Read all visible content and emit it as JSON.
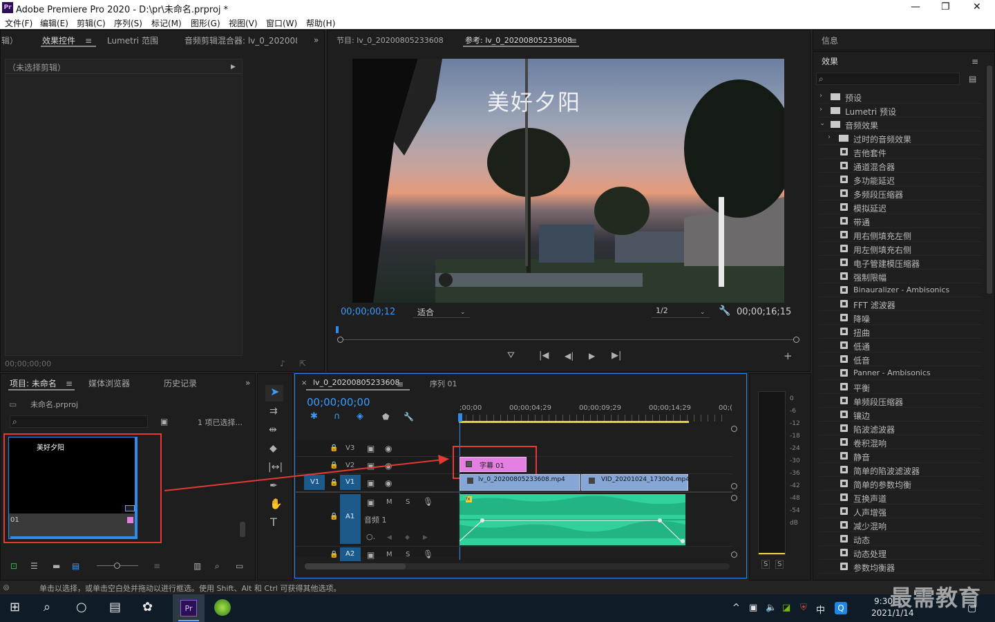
{
  "window": {
    "title": "Adobe Premiere Pro 2020 - D:\\pr\\未命名.prproj *",
    "logo": "Pr"
  },
  "menu": [
    "文件(F)",
    "编辑(E)",
    "剪辑(C)",
    "序列(S)",
    "标记(M)",
    "图形(G)",
    "视图(V)",
    "窗口(W)",
    "帮助(H)"
  ],
  "left_top_tabs": {
    "t0": "辑）",
    "t1": "效果控件",
    "t2": "Lumetri 范围",
    "t3": "音频剪辑混合器: lv_0_202008"
  },
  "effect_controls": {
    "no_clip": "（未选择剪辑）",
    "timecode": "00;00;00;00"
  },
  "monitor_tabs": {
    "program": "节目: lv_0_20200805233608",
    "reference": "参考: lv_0_20200805233608"
  },
  "monitor": {
    "overlay_title": "美好夕阳",
    "timecode_current": "00;00;00;12",
    "fit": "适合",
    "resolution": "1/2",
    "timecode_duration": "00;00;16;15"
  },
  "project": {
    "tabs": [
      "项目: 未命名",
      "媒体浏览器",
      "历史记录"
    ],
    "file": "未命名.prproj",
    "selection": "1 项已选择...",
    "thumb_title": "美好夕阳",
    "thumb_label": "字幕 01",
    "thumb_label_visible": "01"
  },
  "timeline": {
    "tabs": [
      "lv_0_20200805233608",
      "序列 01"
    ],
    "timecode": "00;00;00;00",
    "ruler": [
      ";00;00",
      "00;00;04;29",
      "00;00;09;29",
      "00;00;14;29",
      "00;("
    ],
    "tracks": {
      "v3": "V3",
      "v2": "V2",
      "v1": "V1",
      "a1": "A1",
      "a2": "A2",
      "audio1": "音频 1",
      "m": "M",
      "s": "S"
    },
    "clips": {
      "caption": "字幕 01",
      "video1": "lv_0_20200805233608.mp4",
      "video2": "VID_20201024_173004.mp4"
    }
  },
  "meter": {
    "labels": [
      "0",
      "-6",
      "-12",
      "-18",
      "-24",
      "-30",
      "-36",
      "-42",
      "-48",
      "-54",
      "dB"
    ],
    "solo": "S"
  },
  "right_panels": {
    "info": "信息",
    "effects": "效果"
  },
  "effects_tree": [
    {
      "label": "预设",
      "type": "folder",
      "level": 0,
      "arrow": "›"
    },
    {
      "label": "Lumetri 预设",
      "type": "folder",
      "level": 0,
      "arrow": "›"
    },
    {
      "label": "音频效果",
      "type": "folder",
      "level": 0,
      "arrow": "⌄"
    },
    {
      "label": "过时的音频效果",
      "type": "folder",
      "level": 1,
      "arrow": "›"
    },
    {
      "label": "吉他套件",
      "type": "fx",
      "level": 1
    },
    {
      "label": "通道混合器",
      "type": "fx",
      "level": 1
    },
    {
      "label": "多功能延迟",
      "type": "fx",
      "level": 1
    },
    {
      "label": "多频段压缩器",
      "type": "fx",
      "level": 1
    },
    {
      "label": "模拟延迟",
      "type": "fx",
      "level": 1
    },
    {
      "label": "带通",
      "type": "fx",
      "level": 1
    },
    {
      "label": "用右侧填充左侧",
      "type": "fx",
      "level": 1
    },
    {
      "label": "用左侧填充右侧",
      "type": "fx",
      "level": 1
    },
    {
      "label": "电子管建模压缩器",
      "type": "fx",
      "level": 1
    },
    {
      "label": "强制限幅",
      "type": "fx",
      "level": 1
    },
    {
      "label": "Binauralizer - Ambisonics",
      "type": "fx",
      "level": 1
    },
    {
      "label": "FFT 滤波器",
      "type": "fx",
      "level": 1
    },
    {
      "label": "降噪",
      "type": "fx",
      "level": 1
    },
    {
      "label": "扭曲",
      "type": "fx",
      "level": 1
    },
    {
      "label": "低通",
      "type": "fx",
      "level": 1
    },
    {
      "label": "低音",
      "type": "fx",
      "level": 1
    },
    {
      "label": "Panner - Ambisonics",
      "type": "fx",
      "level": 1
    },
    {
      "label": "平衡",
      "type": "fx",
      "level": 1
    },
    {
      "label": "单频段压缩器",
      "type": "fx",
      "level": 1
    },
    {
      "label": "镶边",
      "type": "fx",
      "level": 1
    },
    {
      "label": "陷波滤波器",
      "type": "fx",
      "level": 1
    },
    {
      "label": "卷积混响",
      "type": "fx",
      "level": 1
    },
    {
      "label": "静音",
      "type": "fx",
      "level": 1
    },
    {
      "label": "简单的陷波滤波器",
      "type": "fx",
      "level": 1
    },
    {
      "label": "简单的参数均衡",
      "type": "fx",
      "level": 1
    },
    {
      "label": "互换声道",
      "type": "fx",
      "level": 1
    },
    {
      "label": "人声增强",
      "type": "fx",
      "level": 1
    },
    {
      "label": "减少混响",
      "type": "fx",
      "level": 1
    },
    {
      "label": "动态",
      "type": "fx",
      "level": 1
    },
    {
      "label": "动态处理",
      "type": "fx",
      "level": 1
    },
    {
      "label": "参数均衡器",
      "type": "fx",
      "level": 1
    }
  ],
  "status": "单击以选择，或单击空白处并拖动以进行框选。使用 Shift、Alt 和 Ctrl 可获得其他选项。",
  "taskbar": {
    "time": "9:30",
    "date": "2021/1/14",
    "ime": "中",
    "watermark": "最需教育"
  },
  "colors": {
    "accent": "#2d8ceb",
    "caption_clip": "#e37fe0",
    "video_clip": "#86a7d6",
    "audio_clip": "#2fd29a",
    "highlight": "#e53935"
  }
}
